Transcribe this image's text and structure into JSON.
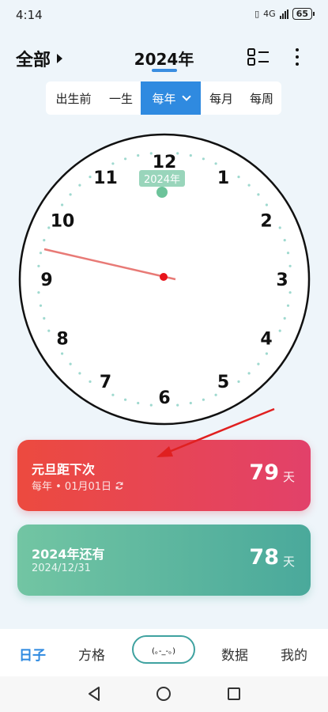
{
  "status_bar": {
    "time": "4:14",
    "network": "4G",
    "battery": "65"
  },
  "header": {
    "all_label": "全部",
    "year_title": "2024年"
  },
  "tabs": [
    {
      "label": "出生前",
      "active": false
    },
    {
      "label": "一生",
      "active": false
    },
    {
      "label": "每年",
      "active": true
    },
    {
      "label": "每月",
      "active": false
    },
    {
      "label": "每周",
      "active": false
    }
  ],
  "clock": {
    "year_label": "2024年",
    "numbers": [
      "12",
      "1",
      "2",
      "3",
      "4",
      "5",
      "6",
      "7",
      "8",
      "9",
      "10",
      "11"
    ]
  },
  "cards": [
    {
      "title": "元旦距下次",
      "subtitle": "每年 • 01月01日",
      "value": "79",
      "unit": "天"
    },
    {
      "title": "2024年还有",
      "subtitle": "2024/12/31",
      "value": "78",
      "unit": "天"
    }
  ],
  "bottom_nav": {
    "days": "日子",
    "grid": "方格",
    "center": "(｡-_-｡)",
    "data": "数据",
    "mine": "我的"
  },
  "colors": {
    "accent": "#2f8ae0",
    "card_red": "#ec4a3f",
    "card_green": "#72c5a3",
    "teal": "#3fa2a0"
  }
}
